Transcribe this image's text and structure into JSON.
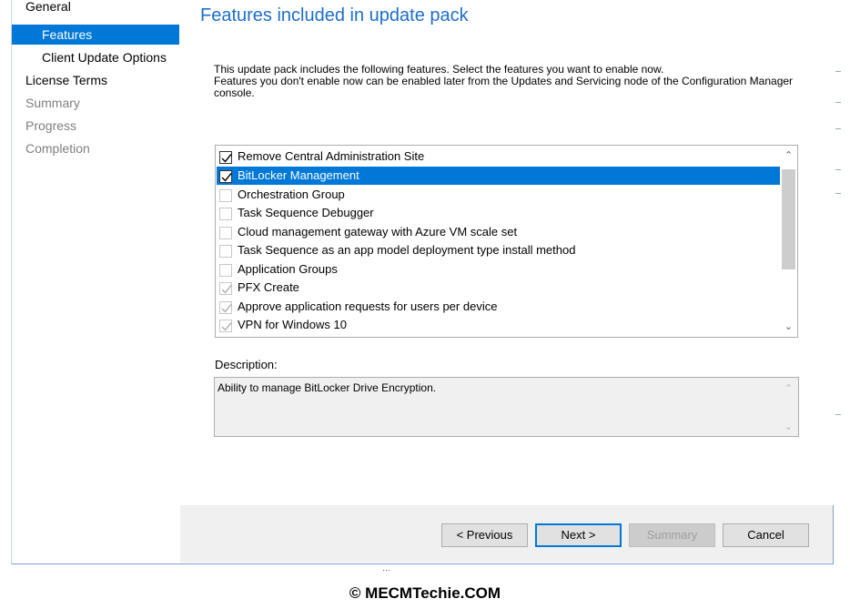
{
  "sidebar": {
    "items": [
      {
        "label": "General"
      },
      {
        "label": "Features"
      },
      {
        "label": "Client Update Options"
      },
      {
        "label": "License Terms"
      },
      {
        "label": "Summary"
      },
      {
        "label": "Progress"
      },
      {
        "label": "Completion"
      }
    ]
  },
  "main": {
    "title": "Features included in update pack",
    "intro_line1": "This update pack includes the following features. Select the features you want to enable now.",
    "intro_line2": "Features you don't enable now can be enabled later from the Updates and Servicing node of the Configuration Manager console.",
    "features": [
      {
        "label": "Remove Central Administration Site",
        "checked": true,
        "disabled": false
      },
      {
        "label": "BitLocker Management",
        "checked": true,
        "disabled": false,
        "selected": true
      },
      {
        "label": "Orchestration Group",
        "checked": false,
        "disabled": false
      },
      {
        "label": "Task Sequence Debugger",
        "checked": false,
        "disabled": false
      },
      {
        "label": "Cloud management gateway with Azure VM scale set",
        "checked": false,
        "disabled": false
      },
      {
        "label": "Task Sequence as an app model deployment type install method",
        "checked": false,
        "disabled": false
      },
      {
        "label": "Application Groups",
        "checked": false,
        "disabled": false
      },
      {
        "label": "PFX Create",
        "checked": true,
        "disabled": true
      },
      {
        "label": "Approve application requests for users per device",
        "checked": true,
        "disabled": true
      },
      {
        "label": "VPN for Windows 10",
        "checked": true,
        "disabled": true
      }
    ],
    "description_label": "Description:",
    "description_text": "Ability to manage BitLocker Drive Encryption."
  },
  "buttons": {
    "previous": "< Previous",
    "next": "Next >",
    "summary": "Summary",
    "cancel": "Cancel"
  },
  "below_strip_text": "…",
  "watermark": "© MECMTechie.COM",
  "colors": {
    "accent": "#0078d7",
    "title": "#1e6ec8",
    "button_bar": "#f0f0f0"
  }
}
